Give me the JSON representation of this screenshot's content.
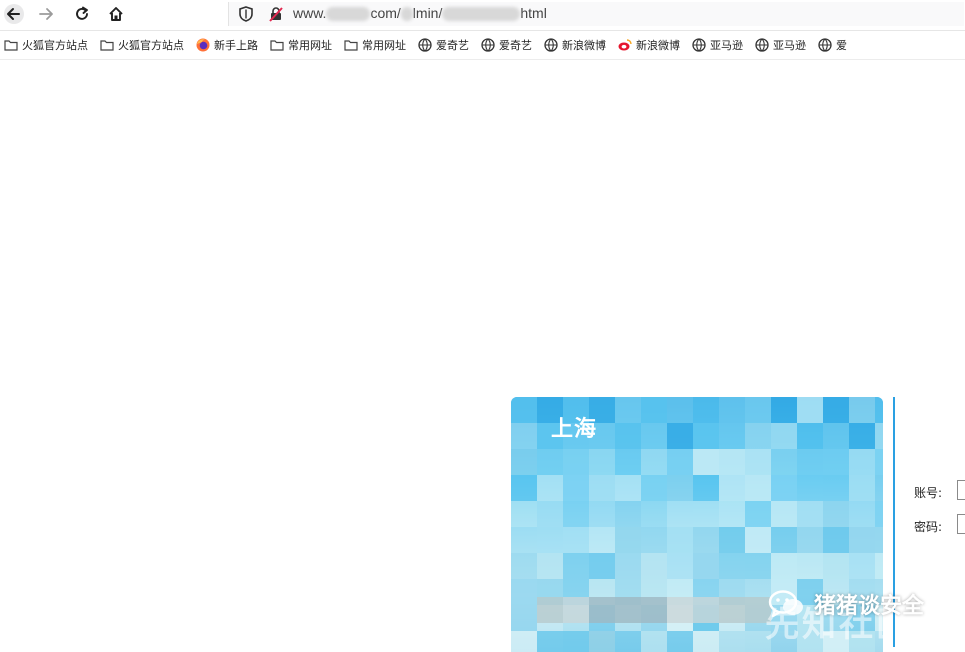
{
  "browser": {
    "url_prefix": "www.",
    "url_mid1": "com/",
    "url_mid2": "lmin/",
    "url_suffix": "html"
  },
  "bookmarks": [
    {
      "label": "火狐官方站点",
      "icon": "folder-icon"
    },
    {
      "label": "火狐官方站点",
      "icon": "folder-icon"
    },
    {
      "label": "新手上路",
      "icon": "firefox-icon"
    },
    {
      "label": "常用网址",
      "icon": "folder-icon"
    },
    {
      "label": "常用网址",
      "icon": "folder-icon"
    },
    {
      "label": "爱奇艺",
      "icon": "globe-icon"
    },
    {
      "label": "爱奇艺",
      "icon": "globe-icon"
    },
    {
      "label": "新浪微博",
      "icon": "globe-icon"
    },
    {
      "label": "新浪微博",
      "icon": "weibo-icon"
    },
    {
      "label": "亚马逊",
      "icon": "globe-icon"
    },
    {
      "label": "亚马逊",
      "icon": "globe-icon"
    },
    {
      "label": "爱",
      "icon": "globe-icon"
    }
  ],
  "login": {
    "card_title": "上海",
    "account_label": "账号:",
    "password_label": "密码:"
  },
  "watermark": {
    "badge_text": "猪猪谈安全",
    "faint_text": "先知社区"
  },
  "colors": {
    "accent": "#2aa0e2",
    "card_top": "#2aa4e3",
    "card_bottom": "#c8ecf5"
  }
}
